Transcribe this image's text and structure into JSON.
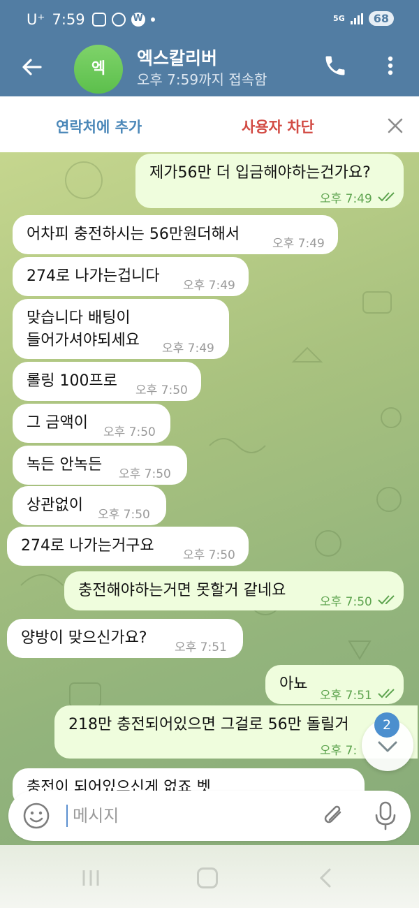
{
  "status_bar": {
    "carrier": "U⁺",
    "time": "7:59",
    "network": "5G",
    "battery": "68"
  },
  "header": {
    "avatar_letter": "엑",
    "contact_name": "엑스칼리버",
    "status": "오후 7:59까지 접속함"
  },
  "action_bar": {
    "add_contact": "연락처에 추가",
    "block_user": "사용자 차단"
  },
  "messages": [
    {
      "dir": "out",
      "text": "제가56만 더 입금해야하는건가요?",
      "time": "오후 7:49"
    },
    {
      "dir": "in",
      "text": "어차피 충전하시는 56만원더해서",
      "time": "오후 7:49"
    },
    {
      "dir": "in",
      "text": "274로 나가는겁니다",
      "time": "오후 7:49"
    },
    {
      "dir": "in",
      "text": "맞습니다 배팅이",
      "text2": "들어가셔야되세요",
      "time": "오후 7:49"
    },
    {
      "dir": "in",
      "text": "롤링 100프로",
      "time": "오후 7:50"
    },
    {
      "dir": "in",
      "text": "그 금액이",
      "time": "오후 7:50"
    },
    {
      "dir": "in",
      "text": "녹든 안녹든",
      "time": "오후 7:50"
    },
    {
      "dir": "in",
      "text": "상관없이",
      "time": "오후 7:50"
    },
    {
      "dir": "in",
      "text": "274로 나가는거구요",
      "time": "오후 7:50"
    },
    {
      "dir": "out",
      "text": "충전해야하는거면 못할거 같네요",
      "time": "오후 7:50"
    },
    {
      "dir": "in",
      "text": "양방이 맞으신가요?",
      "time": "오후 7:51"
    },
    {
      "dir": "out",
      "text": "아뇨",
      "time": "오후 7:51"
    },
    {
      "dir": "out",
      "text": "218만 충전되어있으면 그걸로 56만 돌릴거",
      "time": "오후 7:"
    },
    {
      "dir": "in",
      "text": "충전이 되어있으신게 없죠 벳",
      "time": ""
    }
  ],
  "unread_badge": "2",
  "composer": {
    "placeholder": "메시지"
  },
  "colors": {
    "header": "#527da3",
    "outgoing_bubble": "#effddd",
    "incoming_bubble": "#ffffff",
    "block_red": "#d24a43",
    "link_blue": "#4a87b8"
  }
}
